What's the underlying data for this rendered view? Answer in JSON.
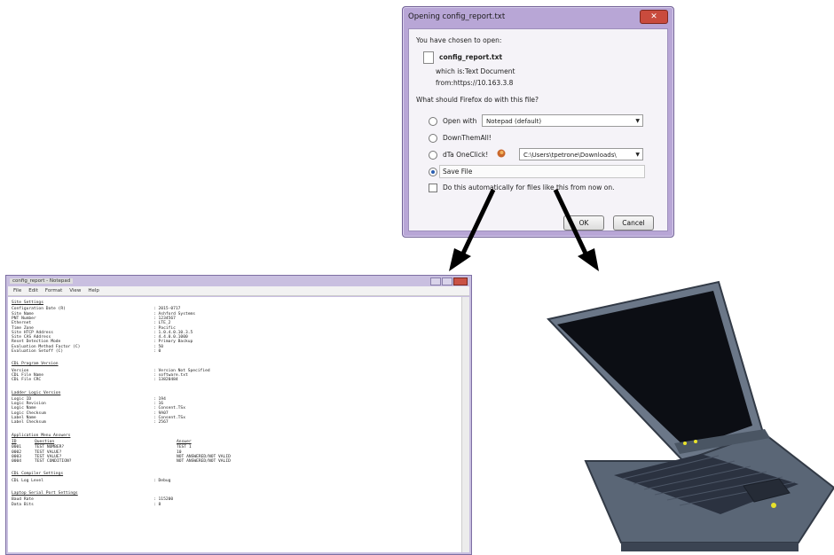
{
  "dialog": {
    "title": "Opening config_report.txt",
    "close": "✕",
    "chosen_text": "You have chosen to open:",
    "filename": "config_report.txt",
    "which_is_label": "which is:",
    "which_is_value": "Text Document",
    "from_label": "from:",
    "from_value": "https://10.163.3.8",
    "question": "What should Firefox do with this file?",
    "options": [
      {
        "label": "Open with",
        "selected": false
      },
      {
        "label": "DownThemAll!",
        "selected": false
      },
      {
        "label": "dTa OneClick!",
        "selected": false
      },
      {
        "label": "Save File",
        "selected": true
      }
    ],
    "open_with_value": "Notepad (default)",
    "onclick_path": "C:\\Users\\tpetrone\\Downloads\\",
    "auto_label": "Do this automatically for files like this from now on.",
    "ok_label": "OK",
    "cancel_label": "Cancel"
  },
  "notepad": {
    "title": "config_report - Notepad",
    "menu": [
      "File",
      "Edit",
      "Format",
      "View",
      "Help"
    ],
    "sections": [
      {
        "heading": "Site Settings",
        "lines": [
          [
            "Configuration Date (R)",
            ": 2015-0717"
          ],
          [
            "Site Name",
            ": Ashford Systems"
          ],
          [
            "PNT Number",
            ": 1234567"
          ],
          [
            "Ethernet",
            ": LTE_2"
          ],
          [
            "Time Zone",
            ": Pacific"
          ],
          [
            "Site HTCP Address",
            ": 1.0.4.0.10.3.5"
          ],
          [
            "Site CAS Address",
            ": 4.4.0.0.1000"
          ],
          [
            "Reset Detection Mode",
            ": Primary Backup"
          ],
          [
            "Evaluation Method Factor (C)",
            ": 50"
          ],
          [
            "Evaluation Setoff (C)",
            ": 0"
          ]
        ]
      },
      {
        "heading": "CDL Program Version",
        "lines": [
          [
            "Version",
            ": Version Not Specified"
          ],
          [
            "CDL File Name",
            ": software.txt"
          ],
          [
            "CDL File CRC",
            ": 13820484"
          ]
        ]
      },
      {
        "heading": "Ladder Logic Version",
        "lines": [
          [
            "Logic ID",
            ": 194"
          ],
          [
            "Logic Revision",
            ": 16"
          ],
          [
            "Logic Name",
            ": Consent.TSx"
          ],
          [
            "Logic Checksum",
            ": 9A07"
          ],
          [
            "Label Name",
            ": Consent.TSx"
          ],
          [
            "Label Checksum",
            ": 2567"
          ]
        ]
      },
      {
        "heading": "Application Menu Answers",
        "columns": [
          "ID",
          "Question",
          "Answer"
        ],
        "rows": [
          [
            "0001",
            "TEST NUMBER?",
            "TEST 1"
          ],
          [
            "0002",
            "TEST VALUE?",
            "10"
          ],
          [
            "0003",
            "TEST VALUE?",
            "NOT ANSWERED/NOT VALID"
          ],
          [
            "0004",
            "TEST CONDITION?",
            "NOT ANSWERED/NOT VALID"
          ]
        ]
      },
      {
        "heading": "CDL Compiler Settings",
        "lines": [
          [
            "CDL Log Level",
            ": Debug"
          ]
        ]
      },
      {
        "heading": "Laptop Serial Port Settings",
        "lines": [
          [
            "Baud Rate",
            ": 115200"
          ],
          [
            "Data Bits",
            ": 8"
          ]
        ]
      }
    ]
  },
  "colors": {
    "dialog_frame": "#b8a6d6",
    "window_frame": "#c9bfe0",
    "close_button": "#c94b3d",
    "laptop_body": "#5a6676",
    "laptop_screen": "#0c0e14",
    "led": "#e8e22a"
  },
  "icons": [
    "document-icon",
    "firefox-icon",
    "close-icon",
    "dropdown-arrow-icon",
    "arrow-icon",
    "laptop-icon"
  ]
}
